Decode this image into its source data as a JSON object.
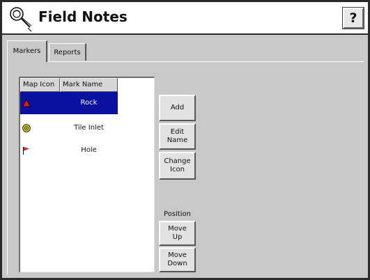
{
  "window": {
    "title": "Field Notes",
    "help_label": "?"
  },
  "tabs": [
    {
      "label": "Markers",
      "active": true
    },
    {
      "label": "Reports",
      "active": false
    }
  ],
  "list": {
    "columns": [
      "Map Icon",
      "Mark Name"
    ],
    "rows": [
      {
        "icon": "red-triangle-icon",
        "name": "Rock",
        "selected": true
      },
      {
        "icon": "yellow-target-icon",
        "name": "Tile Inlet",
        "selected": false
      },
      {
        "icon": "red-flag-icon",
        "name": "Hole",
        "selected": false
      }
    ]
  },
  "buttons": {
    "add": "Add",
    "edit_name": "Edit\nName",
    "change_icon": "Change\nIcon",
    "position_label": "Position",
    "move_up": "Move\nUp",
    "move_down": "Move\nDown"
  },
  "colors": {
    "selection": "#0a10a0",
    "panel": "#c9c9c9"
  }
}
